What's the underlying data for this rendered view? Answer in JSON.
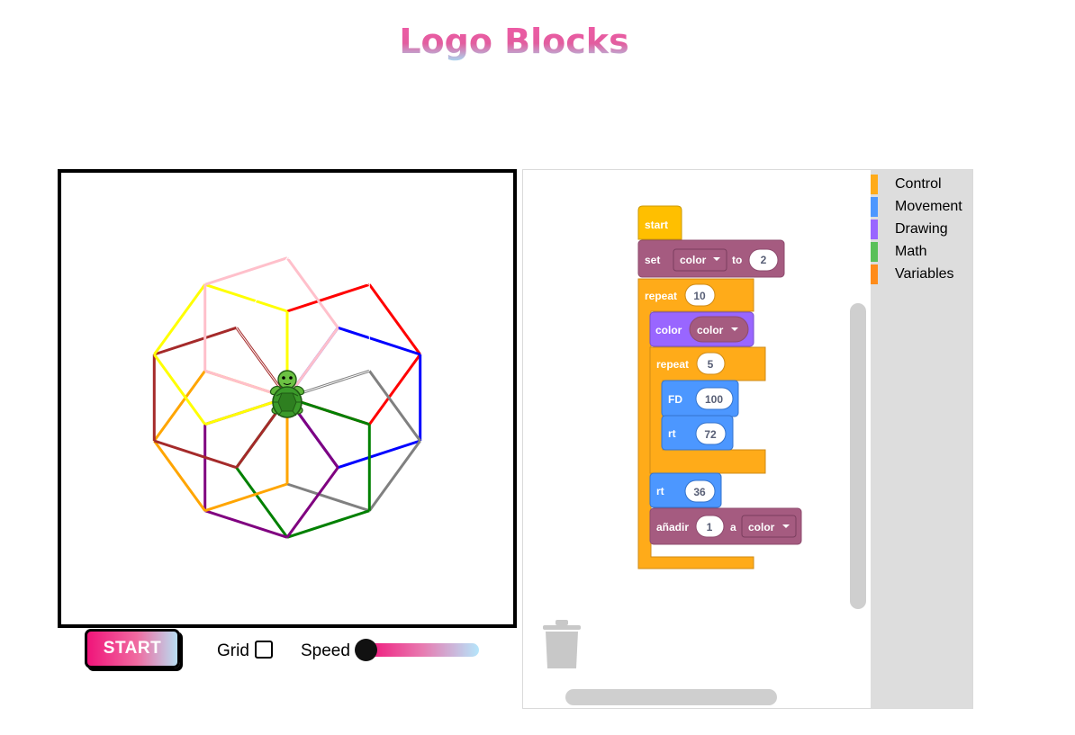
{
  "app": {
    "title": "Logo Blocks"
  },
  "controls": {
    "start_label": "START",
    "grid_label": "Grid",
    "grid_checked": false,
    "speed_label": "Speed",
    "speed_value": 0
  },
  "toolbox": {
    "categories": [
      {
        "label": "Control",
        "color": "#ffab19"
      },
      {
        "label": "Movement",
        "color": "#4c97ff"
      },
      {
        "label": "Drawing",
        "color": "#9966ff"
      },
      {
        "label": "Math",
        "color": "#59c059"
      },
      {
        "label": "Variables",
        "color": "#ff8c1a"
      }
    ]
  },
  "program": {
    "start": "start",
    "set": {
      "keyword": "set",
      "variable": "color",
      "to": "to",
      "value": "2"
    },
    "repeat_outer": {
      "keyword": "repeat",
      "count": "10"
    },
    "color_block": {
      "keyword": "color",
      "variable": "color"
    },
    "repeat_inner": {
      "keyword": "repeat",
      "count": "5"
    },
    "fd": {
      "keyword": "FD",
      "value": "100"
    },
    "rt1": {
      "keyword": "rt",
      "value": "72"
    },
    "rt2": {
      "keyword": "rt",
      "value": "36"
    },
    "add": {
      "keyword": "añadir",
      "value": "1",
      "a": "a",
      "variable": "color"
    }
  },
  "block_colors": {
    "control": "#ffab19",
    "control_dark": "#cf8b17",
    "movement": "#4c97ff",
    "movement_dark": "#3373cc",
    "drawing": "#9966ff",
    "drawing_dark": "#774dcb",
    "variables": "#a55b80",
    "variables_dark": "#8e4b6e"
  },
  "icons": [
    "turtle-icon",
    "trash-icon",
    "dropdown-arrow-icon"
  ],
  "drawing_colors": [
    "#ff0000",
    "#0000ff",
    "#808080",
    "#008000",
    "#800080",
    "#ffa500",
    "#a52a2a",
    "#ffff00",
    "#ffc0cb",
    "#ffffff"
  ]
}
